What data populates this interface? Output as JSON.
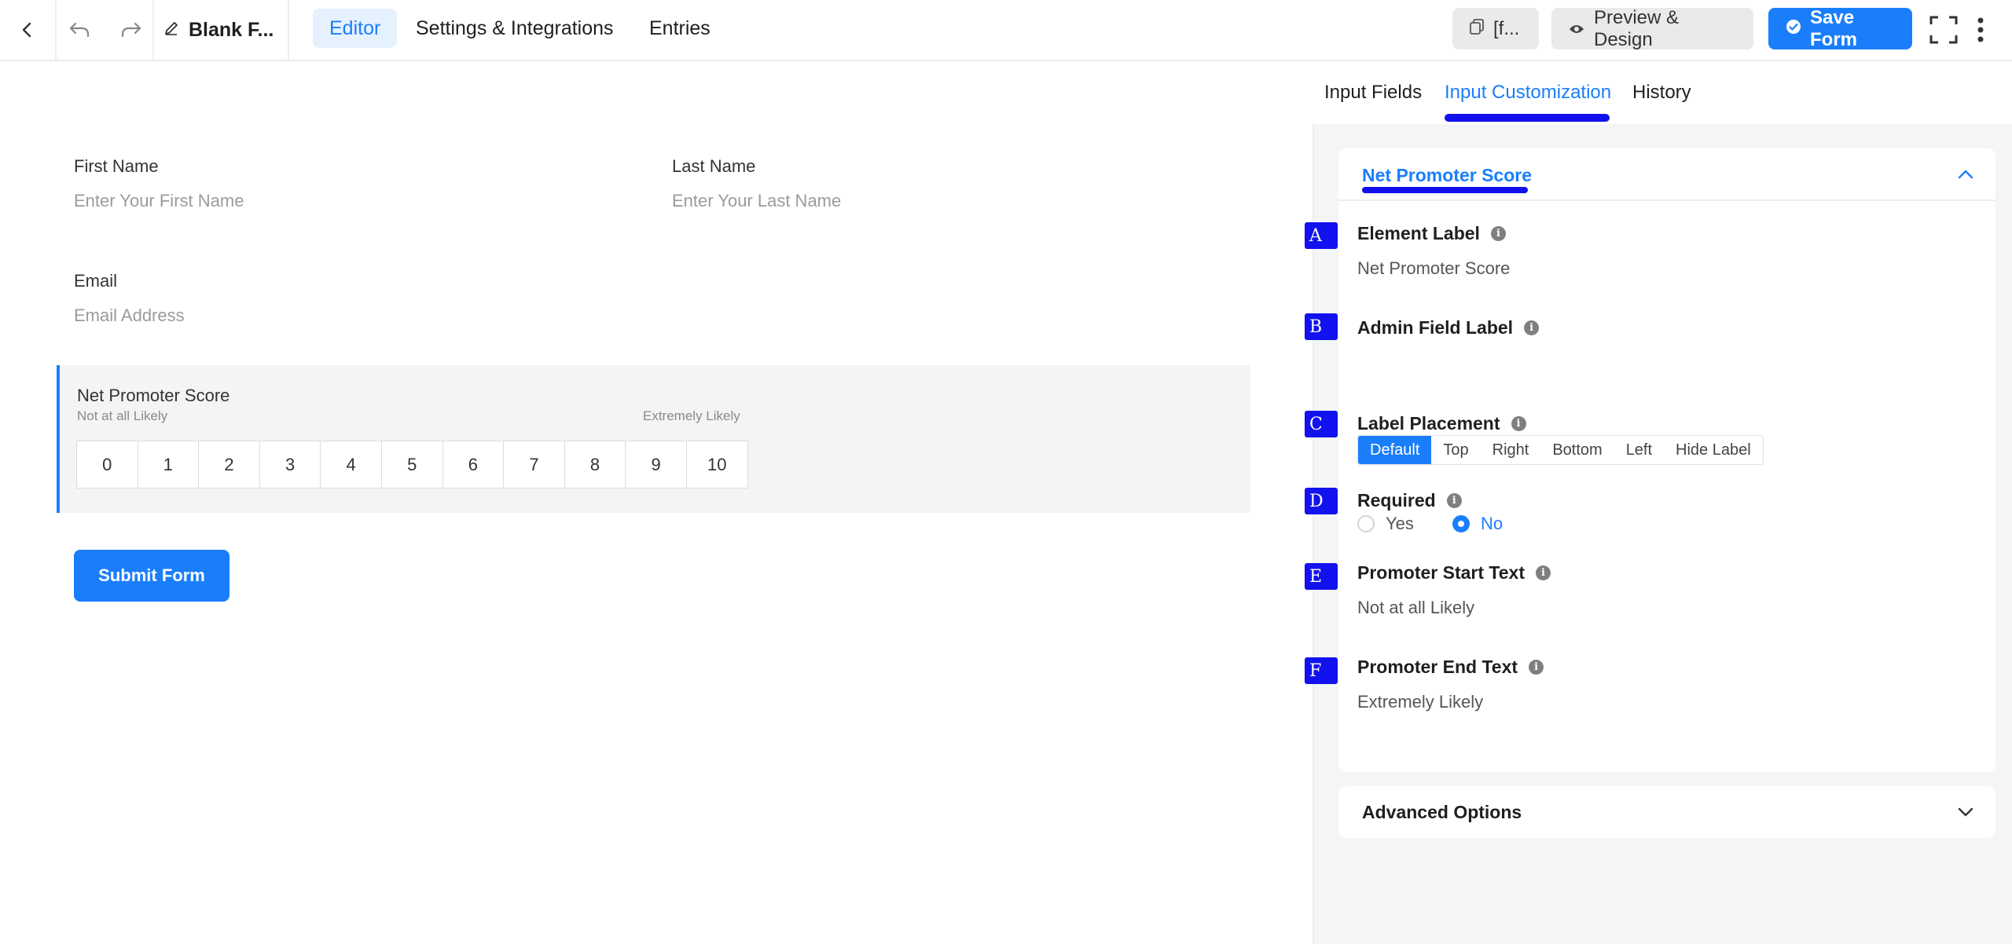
{
  "toolbar": {
    "doc_title": "Blank F...",
    "tabs": [
      {
        "label": "Editor",
        "active": true
      },
      {
        "label": "Settings & Integrations",
        "active": false
      },
      {
        "label": "Entries",
        "active": false
      }
    ],
    "shortcode_label": "[f...",
    "preview_label": "Preview & Design",
    "save_label": "Save Form",
    "icons": [
      "back-icon",
      "undo-icon",
      "redo-icon",
      "pencil-icon",
      "copy-icon",
      "eye-icon",
      "check-circle-icon",
      "fullscreen-icon",
      "more-vertical-icon"
    ]
  },
  "form": {
    "first_name": {
      "label": "First Name",
      "placeholder": "Enter Your First Name"
    },
    "last_name": {
      "label": "Last Name",
      "placeholder": "Enter Your Last Name"
    },
    "email": {
      "label": "Email",
      "placeholder": "Email Address"
    },
    "nps": {
      "title": "Net Promoter Score",
      "start_text": "Not at all Likely",
      "end_text": "Extremely Likely",
      "scale": [
        "0",
        "1",
        "2",
        "3",
        "4",
        "5",
        "6",
        "7",
        "8",
        "9",
        "10"
      ]
    },
    "submit_label": "Submit Form"
  },
  "panel": {
    "tabs": [
      {
        "label": "Input Fields",
        "active": false
      },
      {
        "label": "Input Customization",
        "active": true
      },
      {
        "label": "History",
        "active": false
      }
    ],
    "section_title": "Net Promoter Score",
    "settings": {
      "element_label": {
        "marker": "A",
        "label": "Element Label",
        "value": "Net Promoter Score"
      },
      "admin_field_label": {
        "marker": "B",
        "label": "Admin Field Label",
        "value": ""
      },
      "label_placement": {
        "marker": "C",
        "label": "Label Placement",
        "options": [
          "Default",
          "Top",
          "Right",
          "Bottom",
          "Left",
          "Hide Label"
        ],
        "selected": "Default"
      },
      "required": {
        "marker": "D",
        "label": "Required",
        "yes_label": "Yes",
        "no_label": "No",
        "selected": "No"
      },
      "promoter_start": {
        "marker": "E",
        "label": "Promoter Start Text",
        "value": "Not at all Likely"
      },
      "promoter_end": {
        "marker": "F",
        "label": "Promoter End Text",
        "value": "Extremely Likely"
      }
    },
    "advanced_title": "Advanced Options"
  },
  "colors": {
    "accent": "#1a7efb",
    "marker": "#1212ee",
    "panel_bg": "#f4f5f7"
  }
}
